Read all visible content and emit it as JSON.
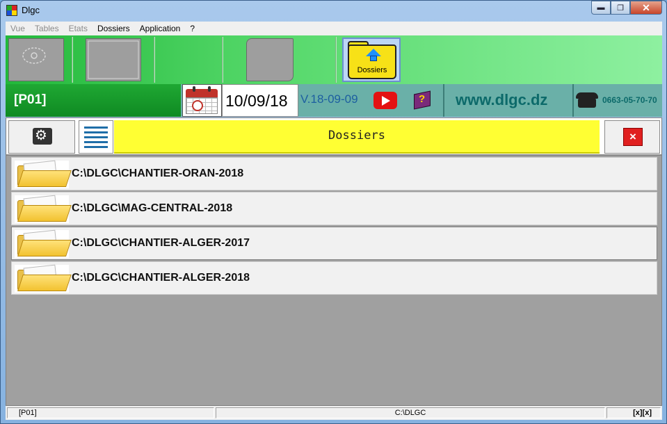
{
  "window": {
    "title": "Dlgc",
    "min": "▬",
    "max": "❐",
    "close": "✕"
  },
  "menu": [
    {
      "label": "Vue",
      "enabled": false
    },
    {
      "label": "Tables",
      "enabled": false
    },
    {
      "label": "Etats",
      "enabled": false
    },
    {
      "label": "Dossiers",
      "enabled": true
    },
    {
      "label": "Application",
      "enabled": true
    },
    {
      "label": "?",
      "enabled": true
    }
  ],
  "toolbar": {
    "dossiers_label": "Dossiers"
  },
  "infobar": {
    "profile": "[P01]",
    "date": "10/09/18",
    "version": "V.18-09-09",
    "website": "www.dlgc.dz",
    "phone": "0663-05-70-70"
  },
  "panel": {
    "title": "Dossiers",
    "close_label": "×",
    "rows": [
      {
        "path": "C:\\DLGC\\CHANTIER-ORAN-2018"
      },
      {
        "path": "C:\\DLGC\\MAG-CENTRAL-2018"
      },
      {
        "path": "C:\\DLGC\\CHANTIER-ALGER-2017"
      },
      {
        "path": "C:\\DLGC\\CHANTIER-ALGER-2018"
      }
    ]
  },
  "statusbar": {
    "profile": "[P01]",
    "path": "C:\\DLGC",
    "right": "[x][x]"
  }
}
